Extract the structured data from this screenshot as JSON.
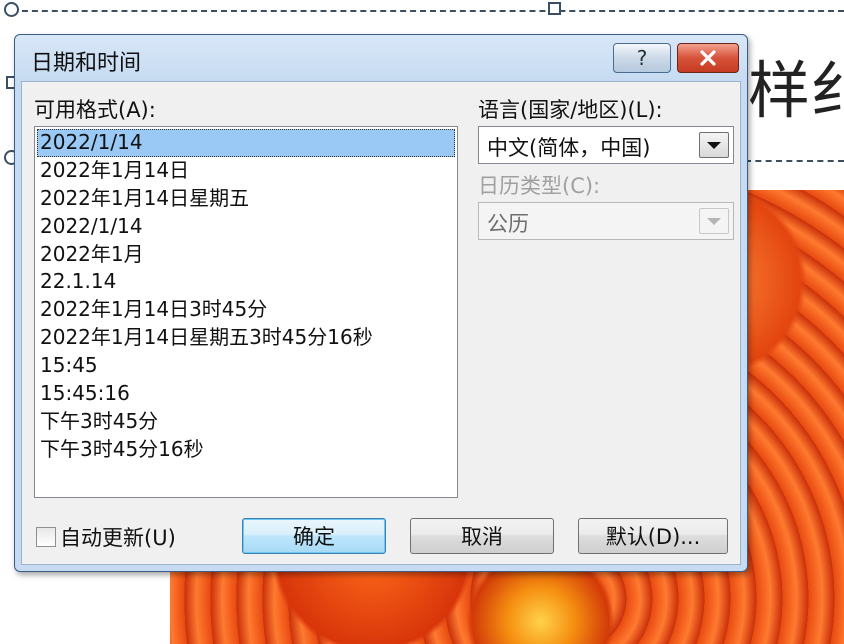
{
  "slide": {
    "title_fragment": "样纟"
  },
  "dialog": {
    "title": "日期和时间",
    "help_label": "?",
    "labels": {
      "formats": "可用格式(A):",
      "language": "语言(国家/地区)(L):",
      "calendar": "日历类型(C):"
    },
    "formats": [
      "2022/1/14",
      "2022年1月14日",
      "2022年1月14日星期五",
      "2022/1/14",
      "2022年1月",
      "22.1.14",
      "2022年1月14日3时45分",
      "2022年1月14日星期五3时45分16秒",
      "15:45",
      "15:45:16",
      "下午3时45分",
      "下午3时45分16秒"
    ],
    "selected_format_index": 0,
    "language_value": "中文(简体，中国)",
    "calendar_value": "公历",
    "auto_update_label": "自动更新(U)",
    "auto_update_checked": false,
    "buttons": {
      "ok": "确定",
      "cancel": "取消",
      "default": "默认(D)..."
    }
  }
}
